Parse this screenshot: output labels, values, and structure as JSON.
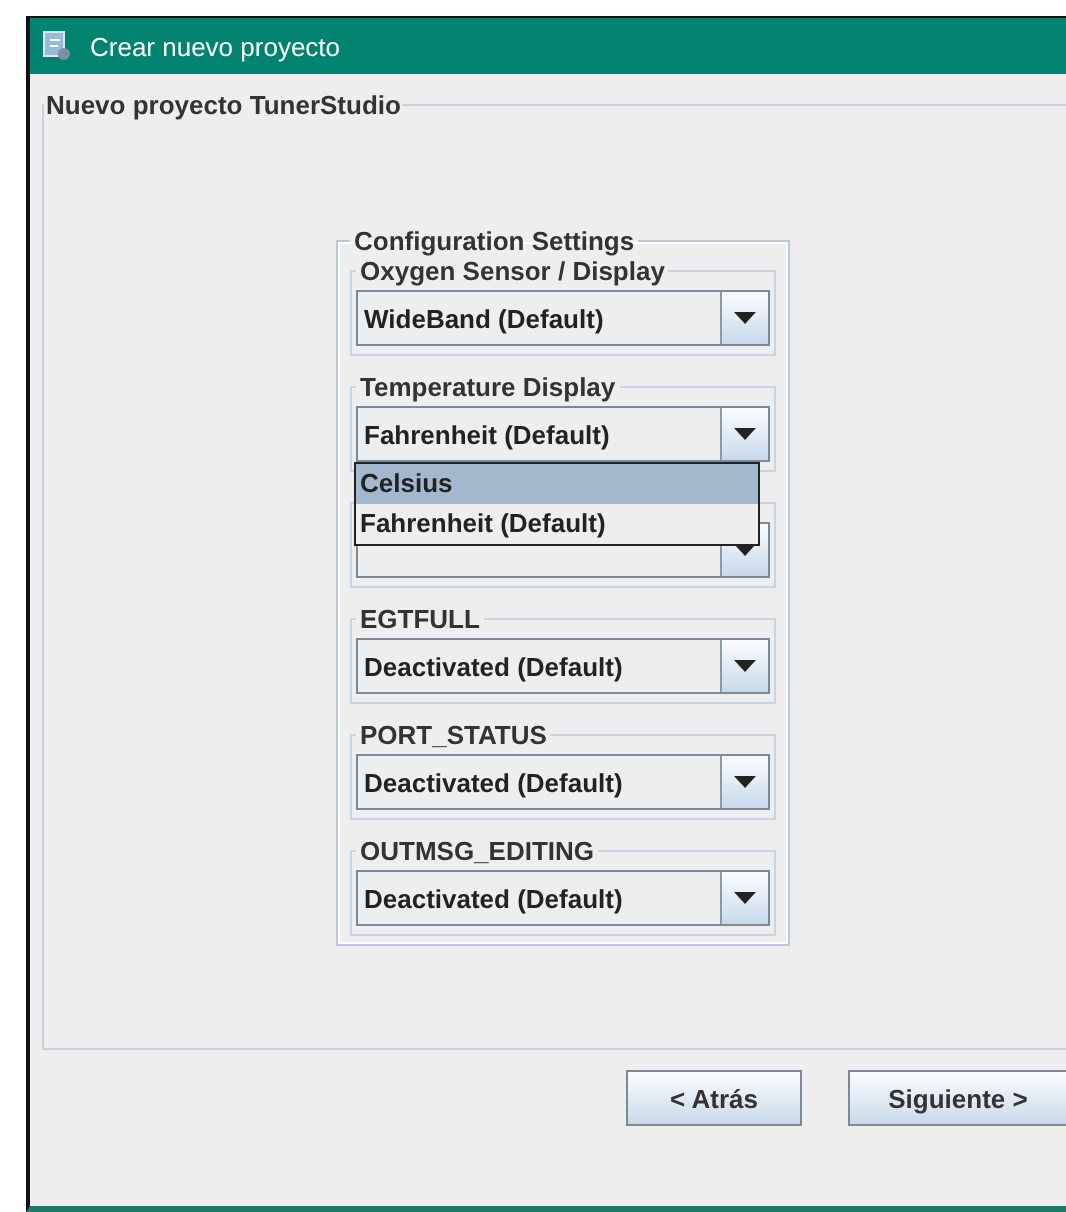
{
  "window": {
    "title": "Crear nuevo proyecto"
  },
  "panel": {
    "title": "Nuevo proyecto TunerStudio"
  },
  "settings": {
    "title": "Configuration Settings",
    "groups": [
      {
        "kind": "setting",
        "title": "Oxygen Sensor / Display",
        "value": "WideBand (Default)"
      },
      {
        "kind": "setting",
        "title": "Temperature Display",
        "value": "Fahrenheit (Default)",
        "expanded": true,
        "options": [
          {
            "label": "Celsius",
            "highlighted": true
          },
          {
            "label": "Fahrenheit (Default)",
            "highlighted": false
          }
        ]
      },
      {
        "kind": "covered"
      },
      {
        "kind": "setting",
        "title": "EGTFULL",
        "value": "Deactivated (Default)"
      },
      {
        "kind": "setting",
        "title": "PORT_STATUS",
        "value": "Deactivated (Default)"
      },
      {
        "kind": "setting",
        "title": "OUTMSG_EDITING",
        "value": "Deactivated (Default)"
      }
    ]
  },
  "buttons": [
    "< Atrás",
    "Siguiente >"
  ]
}
